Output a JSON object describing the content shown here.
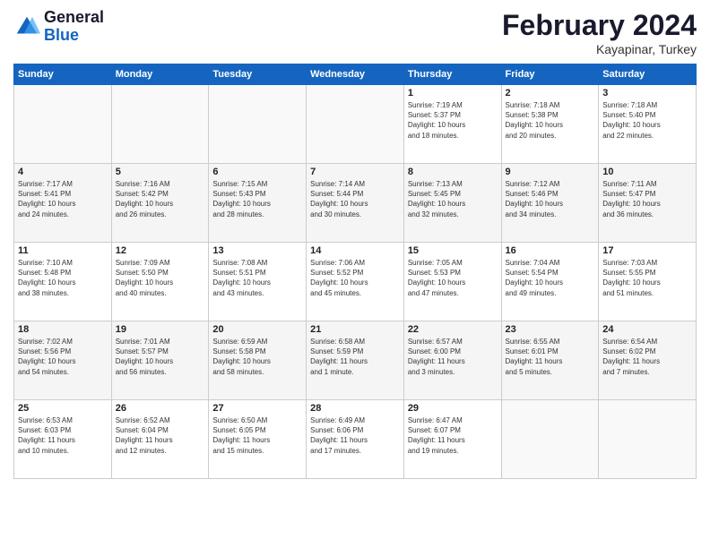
{
  "header": {
    "logo_line1": "General",
    "logo_line2": "Blue",
    "month": "February 2024",
    "location": "Kayapinar, Turkey"
  },
  "weekdays": [
    "Sunday",
    "Monday",
    "Tuesday",
    "Wednesday",
    "Thursday",
    "Friday",
    "Saturday"
  ],
  "weeks": [
    [
      {
        "day": "",
        "info": ""
      },
      {
        "day": "",
        "info": ""
      },
      {
        "day": "",
        "info": ""
      },
      {
        "day": "",
        "info": ""
      },
      {
        "day": "1",
        "info": "Sunrise: 7:19 AM\nSunset: 5:37 PM\nDaylight: 10 hours\nand 18 minutes."
      },
      {
        "day": "2",
        "info": "Sunrise: 7:18 AM\nSunset: 5:38 PM\nDaylight: 10 hours\nand 20 minutes."
      },
      {
        "day": "3",
        "info": "Sunrise: 7:18 AM\nSunset: 5:40 PM\nDaylight: 10 hours\nand 22 minutes."
      }
    ],
    [
      {
        "day": "4",
        "info": "Sunrise: 7:17 AM\nSunset: 5:41 PM\nDaylight: 10 hours\nand 24 minutes."
      },
      {
        "day": "5",
        "info": "Sunrise: 7:16 AM\nSunset: 5:42 PM\nDaylight: 10 hours\nand 26 minutes."
      },
      {
        "day": "6",
        "info": "Sunrise: 7:15 AM\nSunset: 5:43 PM\nDaylight: 10 hours\nand 28 minutes."
      },
      {
        "day": "7",
        "info": "Sunrise: 7:14 AM\nSunset: 5:44 PM\nDaylight: 10 hours\nand 30 minutes."
      },
      {
        "day": "8",
        "info": "Sunrise: 7:13 AM\nSunset: 5:45 PM\nDaylight: 10 hours\nand 32 minutes."
      },
      {
        "day": "9",
        "info": "Sunrise: 7:12 AM\nSunset: 5:46 PM\nDaylight: 10 hours\nand 34 minutes."
      },
      {
        "day": "10",
        "info": "Sunrise: 7:11 AM\nSunset: 5:47 PM\nDaylight: 10 hours\nand 36 minutes."
      }
    ],
    [
      {
        "day": "11",
        "info": "Sunrise: 7:10 AM\nSunset: 5:48 PM\nDaylight: 10 hours\nand 38 minutes."
      },
      {
        "day": "12",
        "info": "Sunrise: 7:09 AM\nSunset: 5:50 PM\nDaylight: 10 hours\nand 40 minutes."
      },
      {
        "day": "13",
        "info": "Sunrise: 7:08 AM\nSunset: 5:51 PM\nDaylight: 10 hours\nand 43 minutes."
      },
      {
        "day": "14",
        "info": "Sunrise: 7:06 AM\nSunset: 5:52 PM\nDaylight: 10 hours\nand 45 minutes."
      },
      {
        "day": "15",
        "info": "Sunrise: 7:05 AM\nSunset: 5:53 PM\nDaylight: 10 hours\nand 47 minutes."
      },
      {
        "day": "16",
        "info": "Sunrise: 7:04 AM\nSunset: 5:54 PM\nDaylight: 10 hours\nand 49 minutes."
      },
      {
        "day": "17",
        "info": "Sunrise: 7:03 AM\nSunset: 5:55 PM\nDaylight: 10 hours\nand 51 minutes."
      }
    ],
    [
      {
        "day": "18",
        "info": "Sunrise: 7:02 AM\nSunset: 5:56 PM\nDaylight: 10 hours\nand 54 minutes."
      },
      {
        "day": "19",
        "info": "Sunrise: 7:01 AM\nSunset: 5:57 PM\nDaylight: 10 hours\nand 56 minutes."
      },
      {
        "day": "20",
        "info": "Sunrise: 6:59 AM\nSunset: 5:58 PM\nDaylight: 10 hours\nand 58 minutes."
      },
      {
        "day": "21",
        "info": "Sunrise: 6:58 AM\nSunset: 5:59 PM\nDaylight: 11 hours\nand 1 minute."
      },
      {
        "day": "22",
        "info": "Sunrise: 6:57 AM\nSunset: 6:00 PM\nDaylight: 11 hours\nand 3 minutes."
      },
      {
        "day": "23",
        "info": "Sunrise: 6:55 AM\nSunset: 6:01 PM\nDaylight: 11 hours\nand 5 minutes."
      },
      {
        "day": "24",
        "info": "Sunrise: 6:54 AM\nSunset: 6:02 PM\nDaylight: 11 hours\nand 7 minutes."
      }
    ],
    [
      {
        "day": "25",
        "info": "Sunrise: 6:53 AM\nSunset: 6:03 PM\nDaylight: 11 hours\nand 10 minutes."
      },
      {
        "day": "26",
        "info": "Sunrise: 6:52 AM\nSunset: 6:04 PM\nDaylight: 11 hours\nand 12 minutes."
      },
      {
        "day": "27",
        "info": "Sunrise: 6:50 AM\nSunset: 6:05 PM\nDaylight: 11 hours\nand 15 minutes."
      },
      {
        "day": "28",
        "info": "Sunrise: 6:49 AM\nSunset: 6:06 PM\nDaylight: 11 hours\nand 17 minutes."
      },
      {
        "day": "29",
        "info": "Sunrise: 6:47 AM\nSunset: 6:07 PM\nDaylight: 11 hours\nand 19 minutes."
      },
      {
        "day": "",
        "info": ""
      },
      {
        "day": "",
        "info": ""
      }
    ]
  ]
}
